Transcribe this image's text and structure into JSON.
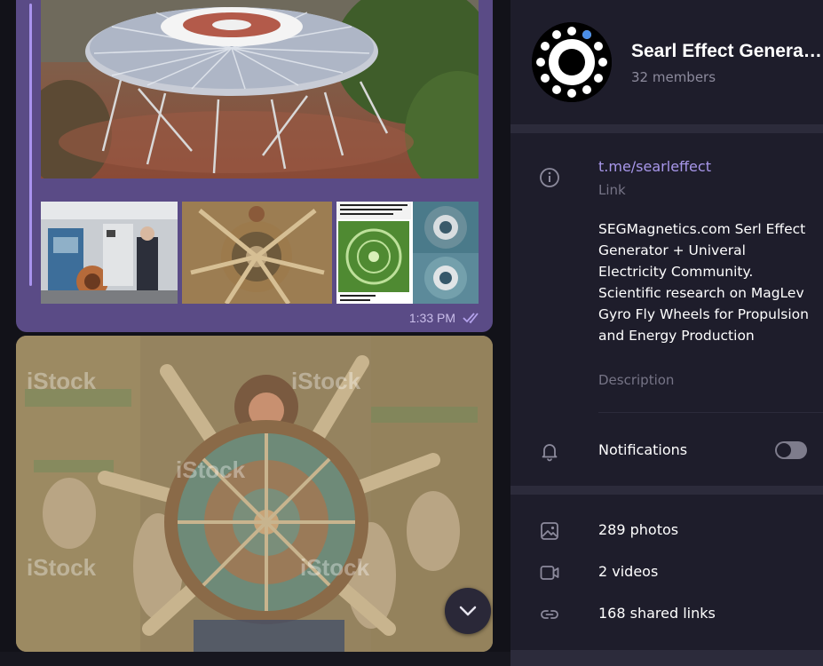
{
  "chat": {
    "message_time": "1:33 PM",
    "read_status_icon": "double-check-icon",
    "scroll_button_icon": "chevron-down-icon",
    "watermark": "iStock"
  },
  "info": {
    "title": "Searl Effect Generator",
    "members": "32 members",
    "link": {
      "value": "t.me/searleffect",
      "label": "Link",
      "icon": "info-icon"
    },
    "description": {
      "text": "SEGMagnetics.com Serl Effect Generator + Univeral Electricity Community. Scientific research on MagLev Gyro Fly Wheels for Propulsion and Energy Production",
      "label": "Description"
    },
    "notifications": {
      "label": "Notifications",
      "enabled": false,
      "icon": "bell-icon"
    },
    "media": {
      "photos": "289 photos",
      "videos": "2 videos",
      "links": "168 shared links",
      "photos_icon": "image-icon",
      "videos_icon": "video-camera-icon",
      "links_icon": "chain-link-icon"
    }
  },
  "colors": {
    "bubble": "#5a4b86",
    "accent": "#a897ea",
    "panel_bg": "#1e1d2b",
    "separator": "#2c2b3b"
  }
}
